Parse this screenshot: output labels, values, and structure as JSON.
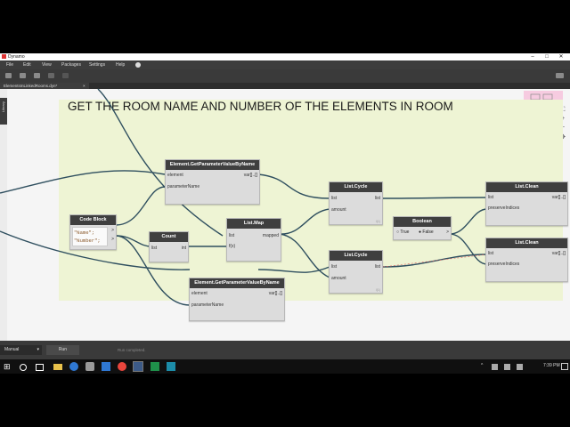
{
  "window": {
    "title": "Dynamo",
    "controls": {
      "minimize": "–",
      "maximize": "□",
      "close": "✕"
    }
  },
  "menu": [
    "File",
    "Edit",
    "View",
    "Packages",
    "Settings",
    "Help"
  ],
  "tab": {
    "name": "ElementsInLinkedRooms.dyn*",
    "close": "×"
  },
  "library_label": "Library",
  "group": {
    "title": "GET THE ROOM NAME AND NUMBER OF THE ELEMENTS IN ROOM",
    "color": "#eef4d4"
  },
  "nodes": {
    "get_param_1": {
      "title": "Element.GetParameterValueByName",
      "inputs": [
        "element",
        "parameterName"
      ],
      "output": "var[]..[]"
    },
    "code_block": {
      "title": "Code Block",
      "lines": [
        "\"Name\";",
        "\"Number\";"
      ],
      "outputs": [
        ">",
        ">"
      ]
    },
    "count": {
      "title": "Count",
      "input": "list",
      "output": "int"
    },
    "list_map": {
      "title": "List.Map",
      "inputs": [
        "list",
        "f(x)"
      ],
      "output": "mapped"
    },
    "get_param_2": {
      "title": "Element.GetParameterValueByName",
      "inputs": [
        "element",
        "parameterName"
      ],
      "output": "var[]..[]"
    },
    "list_cycle_1": {
      "title": "List.Cycle",
      "inputs": [
        "list",
        "amount"
      ],
      "output": "list",
      "lacing": "l(1)"
    },
    "list_cycle_2": {
      "title": "List.Cycle",
      "inputs": [
        "list",
        "amount"
      ],
      "output": "list",
      "lacing": "l(1)"
    },
    "boolean": {
      "title": "Boolean",
      "options": [
        "True",
        "False"
      ],
      "selected": "False",
      "output": ">"
    },
    "list_clean_1": {
      "title": "List.Clean",
      "inputs": [
        "list",
        "preserveIndices"
      ],
      "output": "var[]..[]"
    },
    "list_clean_2": {
      "title": "List.Clean",
      "inputs": [
        "list",
        "preserveIndices"
      ],
      "output": "var[]..[]"
    }
  },
  "statusbar": {
    "run_mode": "Manual",
    "run_mode_arrow": "▾",
    "run_button": "Run",
    "message": "Run completed."
  },
  "taskbar": {
    "time": "7:39 PM"
  },
  "colors": {
    "node_header": "#3f3f3f",
    "node_body": "#dcdcdc",
    "group_bg": "#eef4d4",
    "wire": "#2f4f5f",
    "preview_bg": "#f6cbe0"
  }
}
